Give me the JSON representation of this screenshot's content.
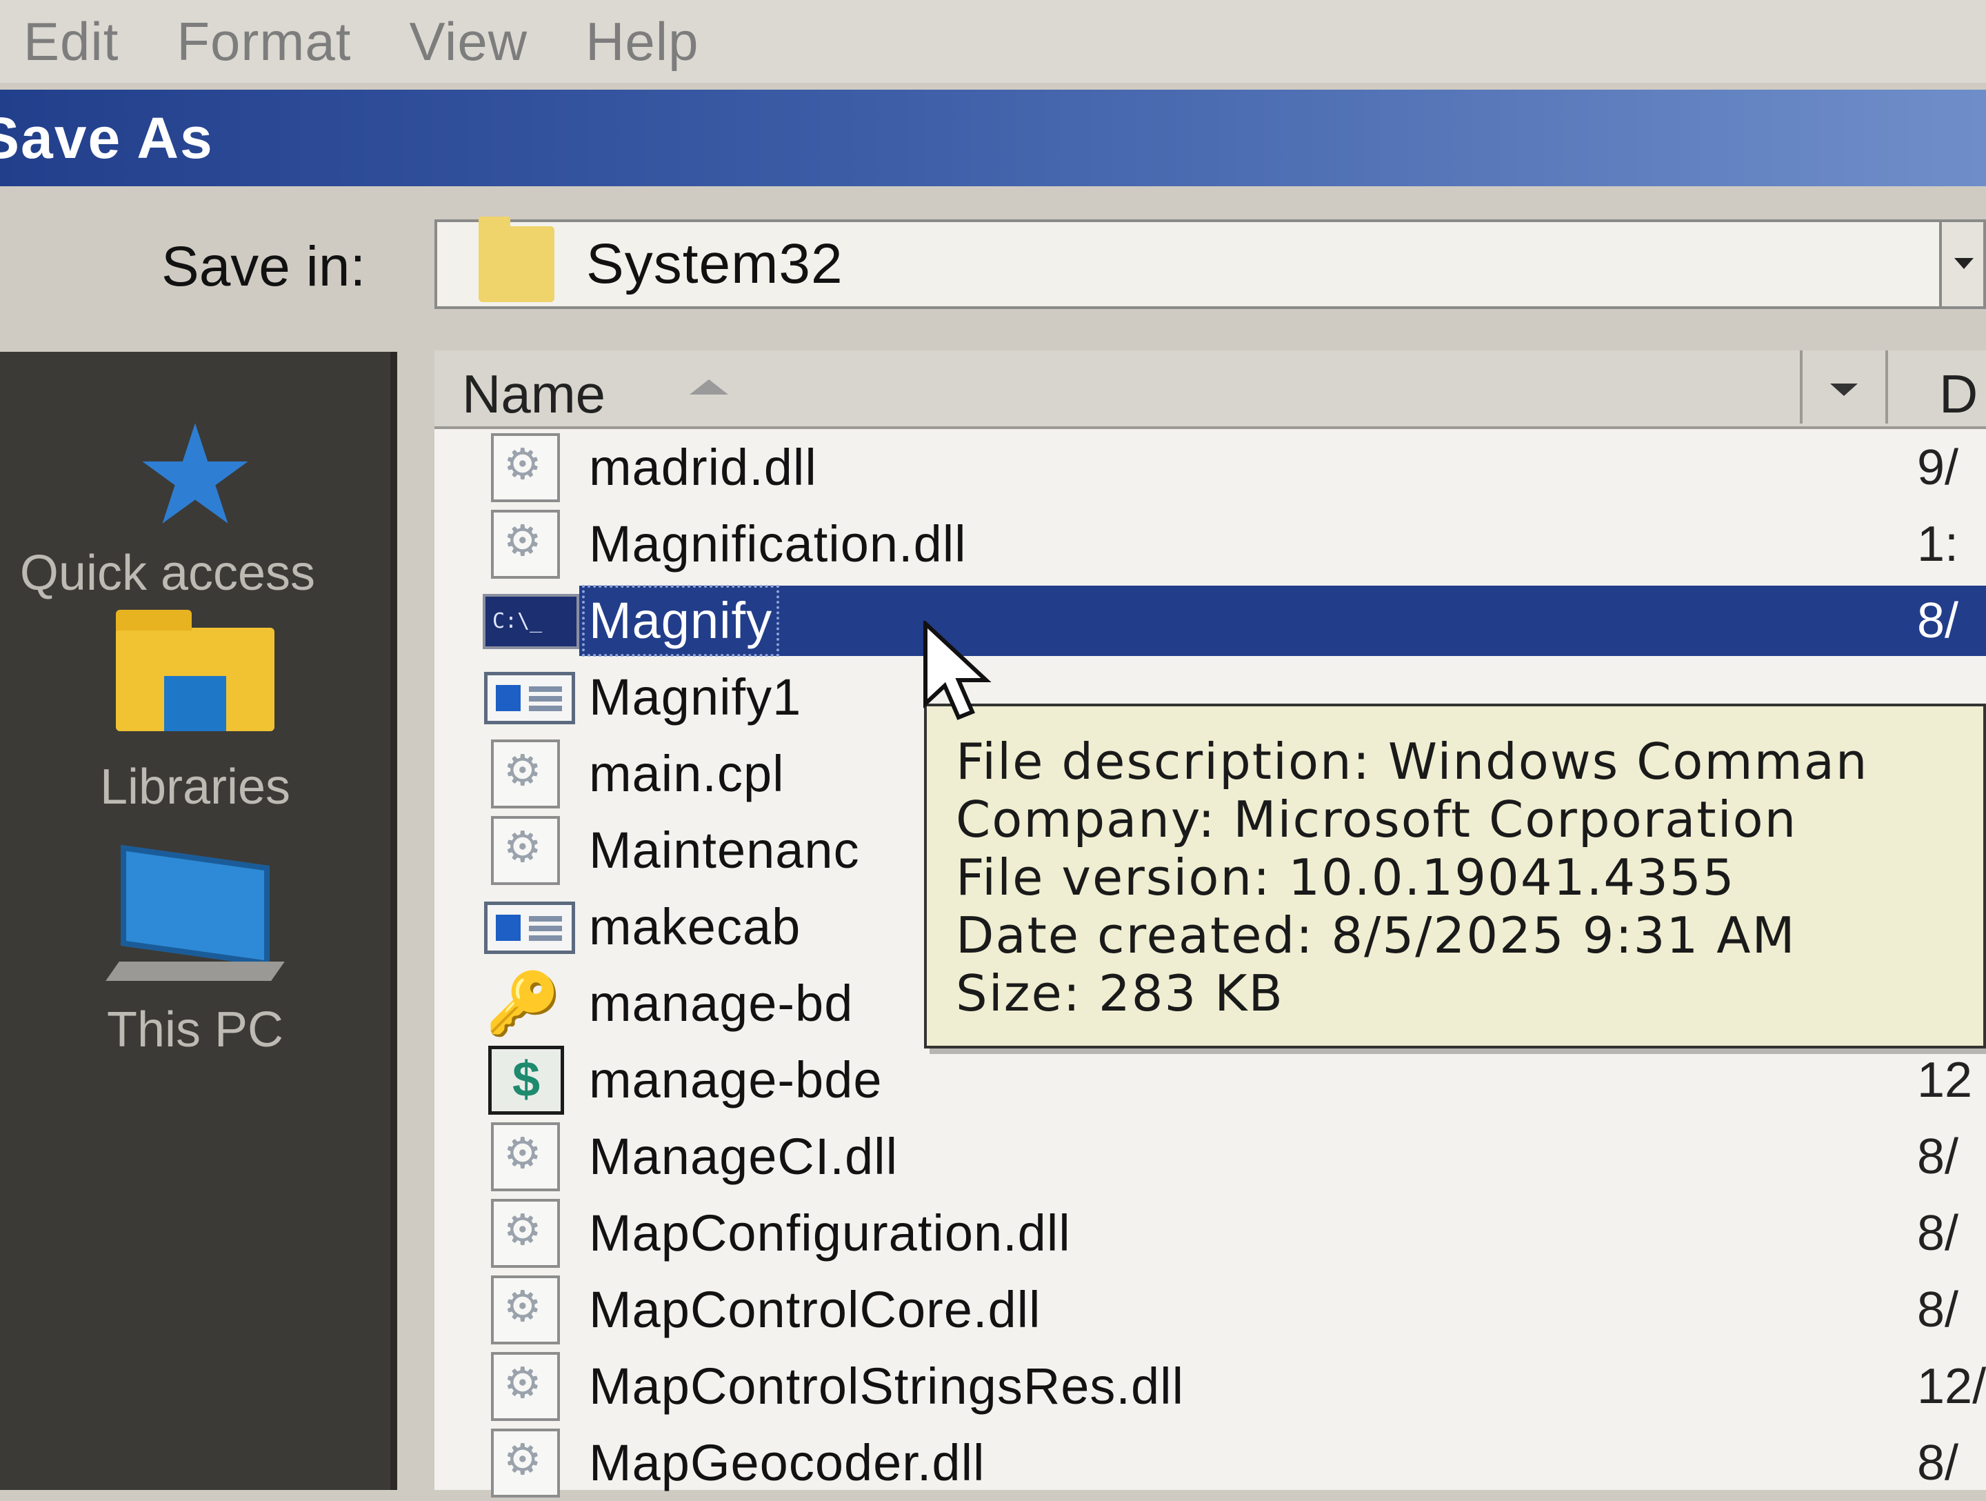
{
  "menu": [
    "Edit",
    "Format",
    "View",
    "Help"
  ],
  "dialog": {
    "title": "Save As"
  },
  "save_in": {
    "label": "Save in:",
    "value": "System32"
  },
  "sidebar": [
    {
      "label": "Quick access",
      "icon": "star-icon"
    },
    {
      "label": "Libraries",
      "icon": "libraries-icon"
    },
    {
      "label": "This PC",
      "icon": "computer-icon"
    }
  ],
  "columns": {
    "name": "Name",
    "date": "D"
  },
  "files": [
    {
      "name": "madrid.dll",
      "type": "dll",
      "date": "9/"
    },
    {
      "name": "Magnification.dll",
      "type": "dll",
      "date": "1:"
    },
    {
      "name": "Magnify",
      "type": "cmd",
      "date": "8/",
      "selected": true
    },
    {
      "name": "Magnify1",
      "type": "exe",
      "date": ""
    },
    {
      "name": "main.cpl",
      "type": "dll",
      "date": ""
    },
    {
      "name": "Maintenanc",
      "type": "dll",
      "date": ""
    },
    {
      "name": "makecab",
      "type": "exe",
      "date": ""
    },
    {
      "name": "manage-bd",
      "type": "lock",
      "date": ""
    },
    {
      "name": "manage-bde",
      "type": "bde",
      "date": "12"
    },
    {
      "name": "ManageCI.dll",
      "type": "dll",
      "date": "8/"
    },
    {
      "name": "MapConfiguration.dll",
      "type": "dll",
      "date": "8/"
    },
    {
      "name": "MapControlCore.dll",
      "type": "dll",
      "date": "8/"
    },
    {
      "name": "MapControlStringsRes.dll",
      "type": "dll",
      "date": "12/"
    },
    {
      "name": "MapGeocoder.dll",
      "type": "dll",
      "date": "8/"
    }
  ],
  "tooltip": {
    "description": "File description: Windows Comman",
    "company": "Company: Microsoft Corporation",
    "version": "File version: 10.0.19041.4355",
    "created": "Date created: 8/5/2025 9:31 AM",
    "size": "Size: 283 KB"
  },
  "colors": {
    "selection": "#223d8a",
    "titlebar": "#223f8c",
    "tooltip_bg": "#efeed2"
  }
}
